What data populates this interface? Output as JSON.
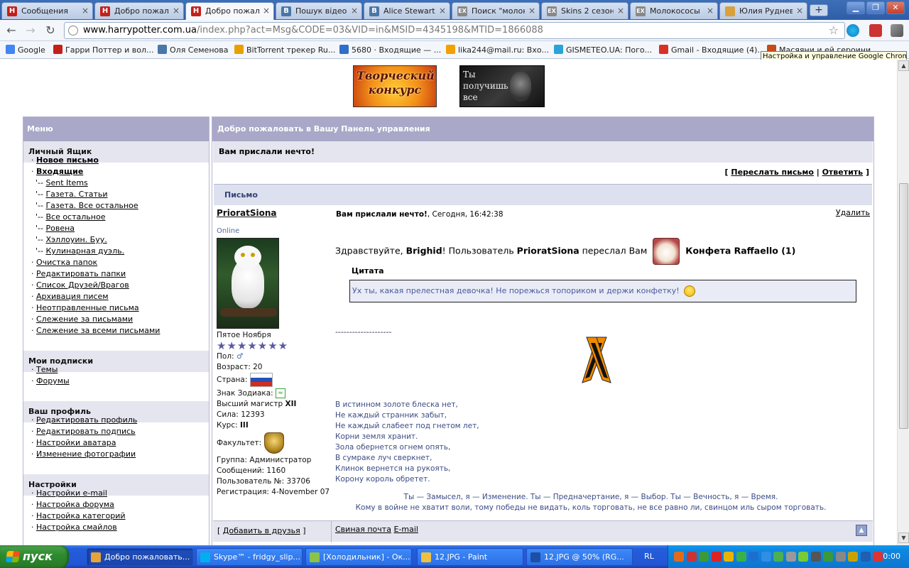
{
  "browser": {
    "tabs": [
      {
        "title": "Сообщения",
        "icon": "hp",
        "active": false
      },
      {
        "title": "Добро пожаловать",
        "icon": "hp",
        "active": false
      },
      {
        "title": "Добро пожаловать",
        "icon": "hp",
        "active": true
      },
      {
        "title": "Пошук відеозап",
        "icon": "vk",
        "active": false
      },
      {
        "title": "Alice Stewart - о",
        "icon": "vk",
        "active": false
      },
      {
        "title": "Поиск \"молокос",
        "icon": "ex",
        "active": false
      },
      {
        "title": "Skins 2 сезон",
        "icon": "ex",
        "active": false
      },
      {
        "title": "Молокососы (2",
        "icon": "ex",
        "active": false
      },
      {
        "title": "Юлия Руднева",
        "icon": "yu",
        "active": false
      }
    ],
    "new_tab_label": "+",
    "window_controls": {
      "minimize": "▁",
      "maximize": "❐",
      "close": "✕"
    },
    "back_icon": "←",
    "forward_icon": "→",
    "reload_icon": "↻",
    "url_domain": "www.harrypotter.com.ua",
    "url_path": "/index.php?act=Msg&CODE=03&VID=in&MSID=4345198&MTID=1866088",
    "bookmark_star": "☆",
    "bookmarks": [
      {
        "label": "Google",
        "color": "#4285f4"
      },
      {
        "label": "Гарри Поттер и вол...",
        "color": "#c41f1a"
      },
      {
        "label": "Оля Семенова",
        "color": "#4a76a8"
      },
      {
        "label": "BitTorrent трекер Ru...",
        "color": "#e8a000"
      },
      {
        "label": "5680 · Входящие — ...",
        "color": "#2f6ec9"
      },
      {
        "label": "lika244@mail.ru: Вхо...",
        "color": "#f2a100"
      },
      {
        "label": "GISMETEO.UA: Пого...",
        "color": "#2aa3d8"
      },
      {
        "label": "Gmail - Входящие (4)...",
        "color": "#d93025"
      },
      {
        "label": "Масяяни и ей героини",
        "color": "#c74a1b"
      }
    ],
    "tooltip": "Настройка и управление Google Chrome"
  },
  "page": {
    "banners": {
      "contest": "Творческий конкурс",
      "get": "Ты получишь все"
    },
    "menu": {
      "title": "Меню",
      "sections": [
        {
          "title": "Личный Ящик",
          "items": [
            {
              "label": "Новое письмо",
              "bold": true,
              "sub": false
            },
            {
              "label": "Входящие",
              "bold": true,
              "sub": false
            },
            {
              "label": "Sent Items",
              "bold": false,
              "sub": true
            },
            {
              "label": "Газета. Статьи",
              "bold": false,
              "sub": true
            },
            {
              "label": "Газета. Все остальное",
              "bold": false,
              "sub": true
            },
            {
              "label": "Все остальное",
              "bold": false,
              "sub": true
            },
            {
              "label": "Ровена",
              "bold": false,
              "sub": true
            },
            {
              "label": "Хэллоуин. Буу.",
              "bold": false,
              "sub": true
            },
            {
              "label": "Кулинарная дуэль.",
              "bold": false,
              "sub": true
            },
            {
              "label": "Очистка папок",
              "bold": false,
              "sub": false
            },
            {
              "label": "Редактировать папки",
              "bold": false,
              "sub": false
            },
            {
              "label": "Список Друзей/Врагов",
              "bold": false,
              "sub": false
            },
            {
              "label": "Архивация писем",
              "bold": false,
              "sub": false
            },
            {
              "label": "Неотправленные письма",
              "bold": false,
              "sub": false
            },
            {
              "label": "Слежение за письмами",
              "bold": false,
              "sub": false
            },
            {
              "label": "Слежение за всеми письмами",
              "bold": false,
              "sub": false
            }
          ]
        },
        {
          "title": "Мои подписки",
          "items": [
            {
              "label": "Темы",
              "bold": false,
              "sub": false
            },
            {
              "label": "Форумы",
              "bold": false,
              "sub": false
            }
          ]
        },
        {
          "title": "Ваш профиль",
          "items": [
            {
              "label": "Редактировать профиль",
              "bold": false,
              "sub": false
            },
            {
              "label": "Редактировать подпись",
              "bold": false,
              "sub": false
            },
            {
              "label": "Настройки аватара",
              "bold": false,
              "sub": false
            },
            {
              "label": "Изменение фотографии",
              "bold": false,
              "sub": false
            }
          ]
        },
        {
          "title": "Настройки",
          "items": [
            {
              "label": "Настройки e-mail",
              "bold": false,
              "sub": false
            },
            {
              "label": "Настройка форума",
              "bold": false,
              "sub": false
            },
            {
              "label": "Настройка категорий",
              "bold": false,
              "sub": false
            },
            {
              "label": "Настройка смайлов",
              "bold": false,
              "sub": false
            }
          ]
        }
      ]
    },
    "panel": {
      "title": "Добро пожаловать в Вашу Панель управления",
      "subtitle": "Вам прислали нечто!",
      "forward": "Переслать письмо",
      "reply": "Ответить",
      "letter_header": "Письмо"
    },
    "author": {
      "nick": "PrioratSiona",
      "status": "Online",
      "rank": "Пятое Ноября",
      "stars": "★★★★★★★",
      "gender_label": "Пол:",
      "gender_icon": "♂",
      "age_label": "Возраст:",
      "age": "20",
      "country_label": "Страна:",
      "zodiac_label": "Знак Зодиака:",
      "zodiac_icon": "≈",
      "title_line": "Высший магистр",
      "title_level": "XII",
      "power_label": "Сила:",
      "power": "12393",
      "course_label": "Курс:",
      "course": "III",
      "faculty_label": "Факультет:",
      "group_label": "Группа:",
      "group": "Администратор",
      "posts_label": "Сообщений:",
      "posts": "1160",
      "user_no_label": "Пользователь №:",
      "user_no": "33706",
      "reg_label": "Регистрация:",
      "reg": "4-November 07"
    },
    "message": {
      "subject": "Вам прислали нечто!",
      "date": "Сегодня, 16:42:38",
      "delete": "Удалить",
      "greet_pre": "Здравствуйте, ",
      "recipient": "Brighid",
      "greet_mid": "! Пользователь ",
      "sender": "PrioratSiona",
      "greet_post": " переслал Вам",
      "gift": "Конфета Raffaello (1)",
      "quote_title": "Цитата",
      "quote": "Ух ты, какая прелестная девочка! Не порежься топориком и держи конфетку!",
      "dashes": "--------------------",
      "poem": [
        "В истинном золоте блеска нет,",
        "Не каждый странник забыт,",
        "Не каждый слабеет под гнетом лет,",
        "Корни земля хранит.",
        "Зола обернется огнем опять,",
        "В сумраке луч сверкнет,",
        "Клинок вернется на рукоять,",
        "Корону король обретет."
      ],
      "signature_line1": "Ты — Замысел, я — Изменение. Ты — Предначертание, я — Выбор. Ты — Вечность, я — Время.",
      "signature_line2": "Кому в войне не хватит воли, тому победы не видать, коль торговать, не все равно ли, свинцом иль сыром торговать."
    },
    "footer": {
      "add_friends": "Добавить в друзья",
      "private_mail": "Свиная почта",
      "email": "E-mail",
      "up_icon": "▲"
    }
  },
  "taskbar": {
    "start_label": "пуск",
    "tasks": [
      {
        "label": "Добро пожаловать...",
        "active": true,
        "color": "#e8a33a"
      },
      {
        "label": "Skype™ - fridgy_slip...",
        "active": false,
        "color": "#00aff0"
      },
      {
        "label": "[Холодильник] - Ок...",
        "active": false,
        "color": "#8bc34a"
      },
      {
        "label": "12.JPG - Paint",
        "active": false,
        "color": "#f0c040"
      },
      {
        "label": "12.JPG @ 50% (RG...",
        "active": false,
        "color": "#1d4ea8"
      }
    ],
    "lang": "RL",
    "clock": "20:00"
  }
}
